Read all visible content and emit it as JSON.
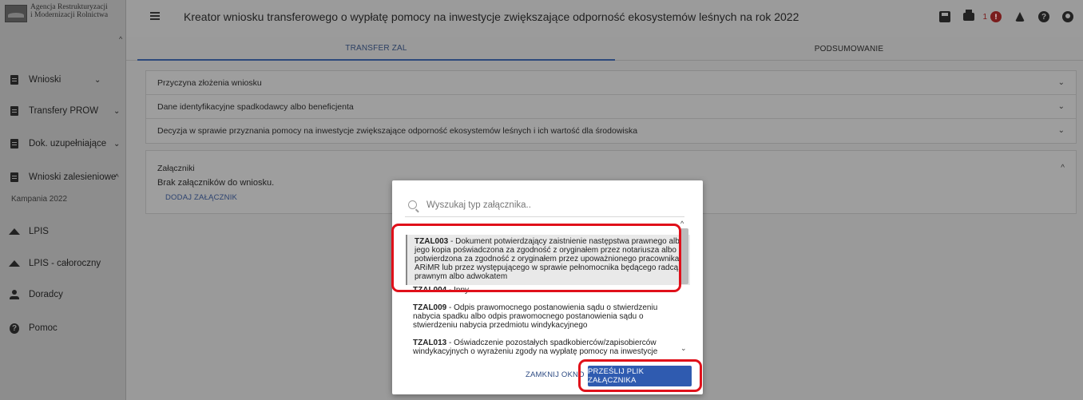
{
  "logo": {
    "line1": "Agencja Restrukturyzacji",
    "line2": "i Modernizacji Rolnictwa"
  },
  "header": {
    "title": "Kreator wniosku transferowego o wypłatę pomocy na inwestycje zwiększające odporność ekosystemów leśnych na rok 2022",
    "alert_count": "1"
  },
  "tabs": [
    {
      "label": "TRANSFER ZAL",
      "active": true
    },
    {
      "label": "PODSUMOWANIE",
      "active": false
    }
  ],
  "sidebar": {
    "items": [
      {
        "label": "Wnioski",
        "icon": "document-icon"
      },
      {
        "label": "Transfery PROW",
        "icon": "document-icon"
      },
      {
        "label": "Dok. uzupełniające",
        "icon": "document-icon"
      },
      {
        "label": "Wnioski zalesieniowe",
        "icon": "document-icon"
      },
      {
        "label": "LPIS",
        "icon": "mountain-icon"
      },
      {
        "label": "LPIS - całoroczny",
        "icon": "mountain-icon"
      },
      {
        "label": "Doradcy",
        "icon": "person-icon"
      },
      {
        "label": "Pomoc",
        "icon": "help-icon"
      }
    ],
    "sub_label": "Kampania 2022"
  },
  "sections": [
    {
      "label": "Przyczyna złożenia wniosku"
    },
    {
      "label": "Dane identyfikacyjne spadkodawcy albo beneficjenta"
    },
    {
      "label": "Decyzja w sprawie przyznania pomocy na inwestycje zwiększające odporność ekosystemów leśnych i ich wartość dla środowiska"
    }
  ],
  "attachments": {
    "title": "Załączniki",
    "empty_text": "Brak załączników do wniosku.",
    "add_label": "DODAJ ZAŁĄCZNIK"
  },
  "modal": {
    "search_placeholder": "Wyszukaj typ załącznika..",
    "items": [
      {
        "code": "TZAL003",
        "text": " - Dokument potwierdzający zaistnienie następstwa prawnego albo jego kopia poświadczona za zgodność z oryginałem przez notariusza albo potwierdzona za zgodność z oryginałem przez upoważnionego pracownika ARiMR lub przez występującego w sprawie pełnomocnika będącego radcą prawnym albo adwokatem"
      },
      {
        "code": "TZAL004",
        "text": " - Inny"
      },
      {
        "code": "TZAL009",
        "text": " - Odpis prawomocnego postanowienia sądu o stwierdzeniu nabycia spadku albo odpis prawomocnego postanowienia sądu o stwierdzeniu nabycia przedmiotu windykacyjnego"
      },
      {
        "code": "TZAL013",
        "text": " - Oświadczenie pozostałych spadkobierców/zapisobierców windykacyjnych o wyrażeniu zgody na wypłatę pomocy na inwestycje"
      }
    ],
    "close_label": "ZAMKNIJ OKNO",
    "upload_label": "PRZEŚLIJ PLIK ZAŁĄCZNIKA"
  },
  "colors": {
    "highlight": "#e0101a",
    "primary": "#2f5bb0"
  }
}
